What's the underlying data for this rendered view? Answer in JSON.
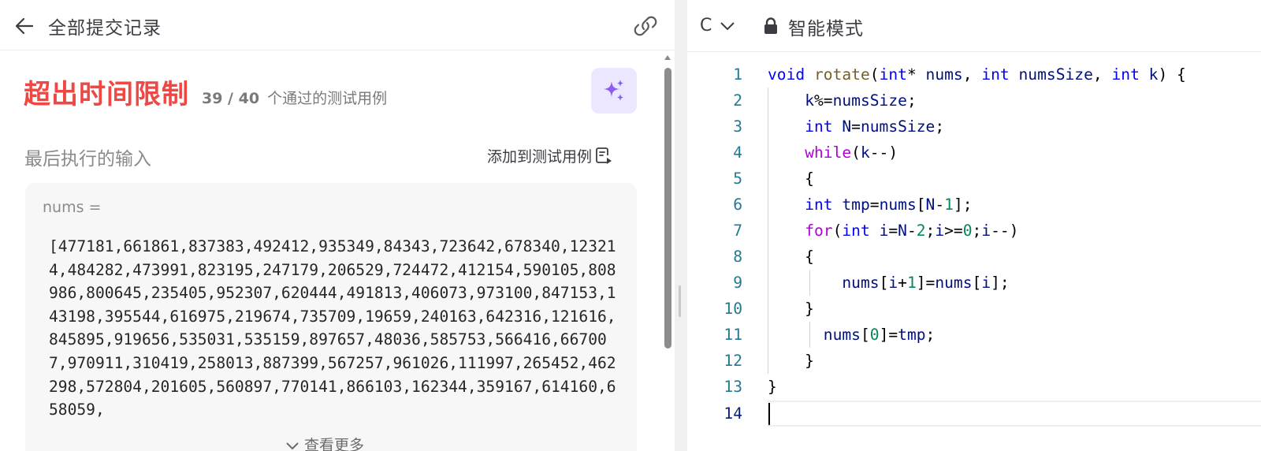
{
  "left": {
    "header_title": "全部提交记录",
    "status": {
      "title": "超出时间限制",
      "count": "39 / 40",
      "desc": "个通过的测试用例"
    },
    "last_input_label": "最后执行的输入",
    "add_testcase_label": "添加到测试用例",
    "input": {
      "var_label": "nums =",
      "value": "[477181,661861,837383,492412,935349,84343,723642,678340,123214,484282,473991,823195,247179,206529,724472,412154,590105,808986,800645,235405,952307,620444,491813,406073,973100,847153,143198,395544,616975,219674,735709,19659,240163,642316,121616,845895,919656,535031,535159,897657,48036,585753,566416,667007,970911,310419,258013,887399,567257,961026,111997,265452,462298,572804,201605,560897,770141,866103,162344,359167,614160,658059,",
      "see_more": "查看更多"
    }
  },
  "right": {
    "language": "C",
    "mode_label": "智能模式",
    "line_numbers": [
      "1",
      "2",
      "3",
      "4",
      "5",
      "6",
      "7",
      "8",
      "9",
      "10",
      "11",
      "12",
      "13",
      "14"
    ],
    "code_lines": [
      "void rotate(int* nums, int numsSize, int k) {",
      "    k%=numsSize;",
      "    int N=numsSize;",
      "    while(k--)",
      "    {",
      "    int tmp=nums[N-1];",
      "    for(int i=N-2;i>=0;i--)",
      "    {",
      "        nums[i+1]=nums[i];",
      "    }",
      "      nums[0]=tmp;",
      "    }",
      "}",
      ""
    ]
  },
  "colors": {
    "status_red": "#ef4743",
    "keyword_blue": "#0000ff",
    "control_purple": "#af00db",
    "function_brown": "#795e26",
    "variable_navy": "#001080",
    "number_green": "#098658",
    "line_number": "#237893",
    "ai_button_bg": "#ece6ff",
    "ai_icon": "#8b5cf6"
  },
  "icons": {
    "back": "arrow-left-icon",
    "link": "link-icon",
    "ai": "sparkles-icon",
    "add_testcase": "file-play-icon",
    "language_dropdown": "chevron-down-icon",
    "lock": "lock-icon",
    "see_more": "chevron-down-icon"
  }
}
